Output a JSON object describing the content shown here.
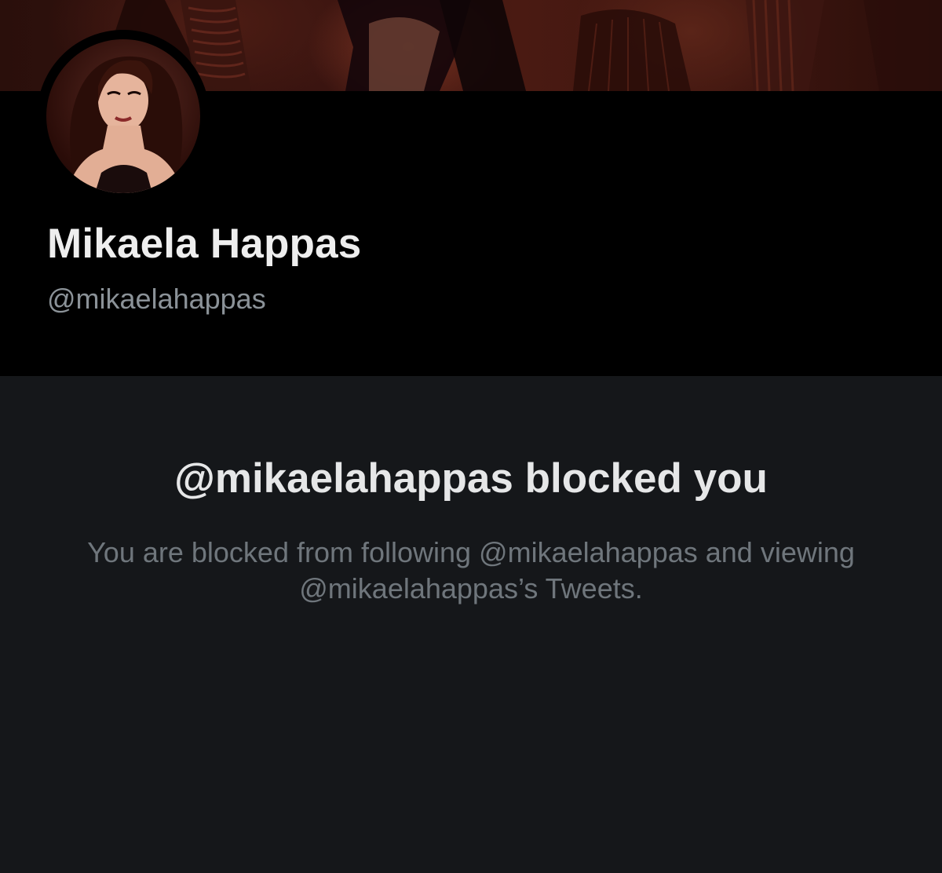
{
  "profile": {
    "display_name": "Mikaela Happas",
    "handle": "@mikaelahappas"
  },
  "blocked": {
    "title": "@mikaelahappas blocked you",
    "message": "You are blocked from following @mikaelahappas and viewing @mikaelahappas’s Tweets."
  },
  "colors": {
    "background_header": "#000000",
    "background_panel": "#15171a",
    "text_primary": "#eeeeee",
    "text_secondary": "#8b9298",
    "banner_tone": "#4a1a12"
  }
}
